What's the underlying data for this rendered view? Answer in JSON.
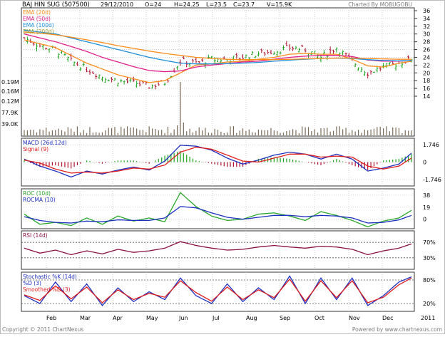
{
  "header": {
    "symbol": "BAJ HIN SUG (507500)",
    "date": "29/12/2010",
    "open": "O=24",
    "high": "H=24.25",
    "low": "L=23.5",
    "close": "C=23.7",
    "volume": "V=15.9K",
    "credit": "Charted By MOBUGOBU"
  },
  "footer": {
    "copyright": "Copyright © 2011 ChartNexus",
    "powered": "Powered by www.chartnexus.com"
  },
  "colors": {
    "ema20": "#ff8c1a",
    "ema50": "#e0208a",
    "ema100": "#1e8fd6",
    "ema200": "#9a9a3a",
    "up": "#17a317",
    "down": "#b0102a",
    "macd": "#1d2fbf",
    "signal": "#e01c1c",
    "roc": "#2aa82a",
    "rocma": "#1d2fbf",
    "rsi": "#8a1040",
    "stoch_k": "#1d2fbf",
    "stoch_d": "#e01c1c",
    "grid": "#c8c8c8"
  },
  "chart_data": [
    {
      "panel": "price",
      "type": "line",
      "legend": [
        "EMA (20d)",
        "EMA (50d)",
        "EMA (100d)",
        "EMA (200d)"
      ],
      "x_ticks": [
        "Feb",
        "Mar",
        "Apr",
        "May",
        "Jun",
        "Jul",
        "Aug",
        "Sep",
        "Oct",
        "Nov",
        "Dec",
        "2011"
      ],
      "y_ticks": [
        36,
        34,
        32,
        30,
        28,
        26,
        24,
        22,
        20,
        18,
        16,
        14
      ],
      "ylim": [
        14,
        36
      ],
      "volume_ticks": [
        "0.19M",
        "0.16M",
        "0.12M",
        "77.9K",
        "39.0K"
      ],
      "x": [
        0,
        10,
        20,
        30,
        40,
        50,
        60,
        70,
        80,
        90,
        100,
        110,
        120,
        130,
        140,
        150,
        160,
        170,
        180,
        190,
        200,
        210,
        220,
        230,
        240,
        248
      ],
      "series": [
        {
          "name": "EMA (20d)",
          "values": [
            28.5,
            27.5,
            26.5,
            24.5,
            22.5,
            21.0,
            19.5,
            18.5,
            17.5,
            18.0,
            20.0,
            22.0,
            22.3,
            22.8,
            23.0,
            23.5,
            24.0,
            24.8,
            25.0,
            24.8,
            24.8,
            23.5,
            21.8,
            21.5,
            22.5,
            23.0
          ]
        },
        {
          "name": "EMA (50d)",
          "values": [
            30.0,
            29.0,
            28.0,
            26.8,
            25.5,
            24.0,
            22.8,
            21.6,
            20.6,
            20.3,
            20.5,
            21.5,
            22.0,
            22.4,
            22.8,
            23.0,
            23.5,
            24.0,
            24.3,
            24.5,
            24.5,
            24.2,
            23.3,
            23.0,
            23.0,
            23.2
          ]
        },
        {
          "name": "EMA (100d)",
          "values": [
            31.0,
            30.5,
            30.0,
            29.0,
            28.0,
            27.0,
            26.0,
            25.0,
            24.0,
            23.2,
            22.5,
            22.3,
            22.3,
            22.4,
            22.5,
            22.7,
            23.0,
            23.3,
            23.5,
            23.7,
            23.8,
            23.7,
            23.4,
            23.2,
            23.1,
            23.2
          ]
        },
        {
          "name": "EMA (200d)",
          "values": [
            30.5,
            30.2,
            29.8,
            29.2,
            28.5,
            27.8,
            27.0,
            26.3,
            25.6,
            25.0,
            24.5,
            24.0,
            23.7,
            23.5,
            23.4,
            23.4,
            23.4,
            23.5,
            23.6,
            23.7,
            23.8,
            23.8,
            23.7,
            23.6,
            23.5,
            23.5
          ]
        },
        {
          "name": "Price",
          "values": [
            29.0,
            27.0,
            26.0,
            23.0,
            21.0,
            19.0,
            18.0,
            17.5,
            16.5,
            17.5,
            23.0,
            22.5,
            23.5,
            23.5,
            24.0,
            25.0,
            25.5,
            26.5,
            26.0,
            24.0,
            26.5,
            23.0,
            20.0,
            21.5,
            22.5,
            23.7
          ]
        }
      ]
    },
    {
      "panel": "macd",
      "type": "line",
      "legend": [
        "MACD (26d,12d)",
        "Signal (9)"
      ],
      "y_ticks": [
        "1.746",
        "0",
        "-1.746"
      ],
      "ylim": [
        -2.4,
        2.4
      ],
      "x": [
        0,
        10,
        20,
        30,
        40,
        50,
        60,
        70,
        80,
        90,
        100,
        110,
        120,
        130,
        140,
        150,
        160,
        170,
        180,
        190,
        200,
        210,
        220,
        230,
        240,
        248
      ],
      "series": [
        {
          "name": "MACD (26d,12d)",
          "values": [
            0.3,
            -0.4,
            -0.9,
            -1.5,
            -0.9,
            -1.2,
            -0.8,
            -0.5,
            -0.8,
            0.1,
            1.7,
            1.6,
            1.2,
            0.4,
            -0.2,
            0.2,
            0.7,
            1.0,
            0.8,
            0.3,
            0.8,
            0.3,
            -0.9,
            -0.6,
            -0.2,
            0.9
          ]
        },
        {
          "name": "Signal (9)",
          "values": [
            0.2,
            -0.1,
            -0.7,
            -1.1,
            -1.0,
            -1.1,
            -0.9,
            -0.6,
            -0.7,
            -0.3,
            1.0,
            1.5,
            1.3,
            0.7,
            0.1,
            0.0,
            0.4,
            0.8,
            0.8,
            0.5,
            0.6,
            0.5,
            -0.4,
            -0.7,
            -0.4,
            0.4
          ]
        }
      ]
    },
    {
      "panel": "roc",
      "type": "line",
      "legend": [
        "ROC (10d)",
        "ROCMA (10)"
      ],
      "y_ticks": [
        "38",
        "19",
        "0"
      ],
      "ylim": [
        -15,
        48
      ],
      "x": [
        0,
        10,
        20,
        30,
        40,
        50,
        60,
        70,
        80,
        90,
        100,
        110,
        120,
        130,
        140,
        150,
        160,
        170,
        180,
        190,
        200,
        210,
        220,
        230,
        240,
        248
      ],
      "series": [
        {
          "name": "ROC (10d)",
          "values": [
            8,
            -8,
            -5,
            -10,
            2,
            -8,
            5,
            -3,
            2,
            -4,
            42,
            20,
            5,
            -2,
            0,
            8,
            10,
            5,
            -2,
            12,
            6,
            -2,
            -12,
            -3,
            2,
            14
          ]
        },
        {
          "name": "ROCMA (10)",
          "values": [
            4,
            -2,
            -5,
            -6,
            -3,
            -4,
            -1,
            -2,
            -2,
            2,
            20,
            18,
            10,
            3,
            0,
            3,
            6,
            6,
            4,
            6,
            5,
            2,
            -6,
            -5,
            -1,
            6
          ]
        }
      ]
    },
    {
      "panel": "rsi",
      "type": "line",
      "legend": [
        "RSI (14d)"
      ],
      "y_ticks": [
        "70%",
        "30%"
      ],
      "ylim": [
        0,
        100
      ],
      "x": [
        0,
        10,
        20,
        30,
        40,
        50,
        60,
        70,
        80,
        90,
        100,
        110,
        120,
        130,
        140,
        150,
        160,
        170,
        180,
        190,
        200,
        210,
        220,
        230,
        240,
        248
      ],
      "series": [
        {
          "name": "RSI (14d)",
          "values": [
            55,
            42,
            50,
            38,
            48,
            40,
            52,
            44,
            48,
            55,
            72,
            62,
            55,
            50,
            52,
            58,
            62,
            58,
            55,
            60,
            58,
            52,
            38,
            48,
            55,
            66
          ]
        }
      ]
    },
    {
      "panel": "stochastic",
      "type": "line",
      "legend": [
        "Stochastic %K (14d)",
        "%D (3)",
        "Smoothed %D (3)"
      ],
      "y_ticks": [
        "80%",
        "20%"
      ],
      "ylim": [
        0,
        100
      ],
      "x": [
        0,
        10,
        20,
        30,
        40,
        50,
        60,
        70,
        80,
        90,
        100,
        110,
        120,
        130,
        140,
        150,
        160,
        170,
        180,
        190,
        200,
        210,
        220,
        230,
        240,
        248
      ],
      "series": [
        {
          "name": "%D (3)",
          "values": [
            40,
            20,
            75,
            25,
            70,
            15,
            60,
            25,
            50,
            30,
            85,
            40,
            20,
            70,
            25,
            60,
            30,
            90,
            20,
            85,
            30,
            85,
            15,
            40,
            75,
            88
          ]
        },
        {
          "name": "Smoothed %D (3)",
          "values": [
            42,
            28,
            65,
            32,
            62,
            22,
            55,
            30,
            46,
            36,
            78,
            48,
            26,
            62,
            30,
            55,
            35,
            82,
            26,
            78,
            35,
            78,
            22,
            36,
            68,
            85
          ]
        }
      ]
    }
  ]
}
